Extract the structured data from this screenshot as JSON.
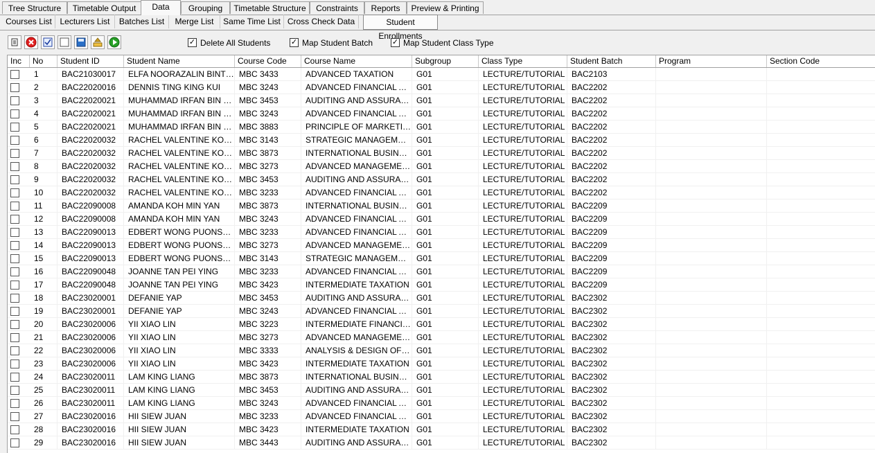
{
  "top_tabs": [
    "Tree Structure",
    "Timetable Output",
    "Data",
    "Grouping",
    "Timetable Structure",
    "Constraints",
    "Reports",
    "Preview & Printing"
  ],
  "active_top_tab": "Data",
  "sub_tabs": [
    "Courses List",
    "Lecturers List",
    "Batches List",
    "Merge List",
    "Same Time List",
    "Cross Check Data",
    "Student Enrollments"
  ],
  "active_sub_tab": "Student Enrollments",
  "toolbar": {
    "icons": [
      "delete-rows-icon",
      "cancel-icon",
      "check-all-icon",
      "uncheck-all-icon",
      "save-icon",
      "import-icon",
      "refresh-icon"
    ],
    "options": [
      {
        "label": "Delete All Students",
        "checked": true
      },
      {
        "label": "Map Student Batch",
        "checked": true
      },
      {
        "label": "Map Student Class Type",
        "checked": true
      }
    ]
  },
  "columns": [
    "Inc",
    "No",
    "Student ID",
    "Student Name",
    "Course Code",
    "Course Name",
    "Subgroup",
    "Class Type",
    "Student Batch",
    "Program",
    "Section Code"
  ],
  "rows": [
    [
      "1",
      "BAC21030017",
      "ELFA NOORAZALIN BINTI JAMAL",
      "MBC 3433",
      "ADVANCED TAXATION",
      "G01",
      "LECTURE/TUTORIAL",
      "BAC2103",
      "",
      ""
    ],
    [
      "2",
      "BAC22020016",
      "DENNIS TING KING KUI",
      "MBC 3243",
      "ADVANCED FINANCIAL ACCOUNTING",
      "G01",
      "LECTURE/TUTORIAL",
      "BAC2202",
      "",
      ""
    ],
    [
      "3",
      "BAC22020021",
      "MUHAMMAD IRFAN BIN HARUN",
      "MBC 3453",
      "AUDITING AND ASSURANCE",
      "G01",
      "LECTURE/TUTORIAL",
      "BAC2202",
      "",
      ""
    ],
    [
      "4",
      "BAC22020021",
      "MUHAMMAD IRFAN BIN HARUN",
      "MBC 3243",
      "ADVANCED FINANCIAL ACCOUNTING",
      "G01",
      "LECTURE/TUTORIAL",
      "BAC2202",
      "",
      ""
    ],
    [
      "5",
      "BAC22020021",
      "MUHAMMAD IRFAN BIN HARUN",
      "MBC 3883",
      "PRINCIPLE OF MARKETING",
      "G01",
      "LECTURE/TUTORIAL",
      "BAC2202",
      "",
      ""
    ],
    [
      "6",
      "BAC22020032",
      "RACHEL VALENTINE KONG",
      "MBC 3143",
      "STRATEGIC MANAGEMENT",
      "G01",
      "LECTURE/TUTORIAL",
      "BAC2202",
      "",
      ""
    ],
    [
      "7",
      "BAC22020032",
      "RACHEL VALENTINE KONG",
      "MBC 3873",
      "INTERNATIONAL BUSINESS",
      "G01",
      "LECTURE/TUTORIAL",
      "BAC2202",
      "",
      ""
    ],
    [
      "8",
      "BAC22020032",
      "RACHEL VALENTINE KONG",
      "MBC 3273",
      "ADVANCED MANAGEMENT ACCOUNTING",
      "G01",
      "LECTURE/TUTORIAL",
      "BAC2202",
      "",
      ""
    ],
    [
      "9",
      "BAC22020032",
      "RACHEL VALENTINE KONG",
      "MBC 3453",
      "AUDITING AND ASSURANCE",
      "G01",
      "LECTURE/TUTORIAL",
      "BAC2202",
      "",
      ""
    ],
    [
      "10",
      "BAC22020032",
      "RACHEL VALENTINE KONG",
      "MBC 3233",
      "ADVANCED FINANCIAL ACCOUNTING",
      "G01",
      "LECTURE/TUTORIAL",
      "BAC2202",
      "",
      ""
    ],
    [
      "11",
      "BAC22090008",
      "AMANDA KOH MIN YAN",
      "MBC 3873",
      "INTERNATIONAL BUSINESS",
      "G01",
      "LECTURE/TUTORIAL",
      "BAC2209",
      "",
      ""
    ],
    [
      "12",
      "BAC22090008",
      "AMANDA KOH MIN YAN",
      "MBC 3243",
      "ADVANCED FINANCIAL ACCOUNTING",
      "G01",
      "LECTURE/TUTORIAL",
      "BAC2209",
      "",
      ""
    ],
    [
      "13",
      "BAC22090013",
      "EDBERT WONG PUONSUN",
      "MBC 3233",
      "ADVANCED FINANCIAL ACCOUNTING",
      "G01",
      "LECTURE/TUTORIAL",
      "BAC2209",
      "",
      ""
    ],
    [
      "14",
      "BAC22090013",
      "EDBERT WONG PUONSUN",
      "MBC 3273",
      "ADVANCED MANAGEMENT ACCOUNTING",
      "G01",
      "LECTURE/TUTORIAL",
      "BAC2209",
      "",
      ""
    ],
    [
      "15",
      "BAC22090013",
      "EDBERT WONG PUONSUN",
      "MBC 3143",
      "STRATEGIC MANAGEMENT",
      "G01",
      "LECTURE/TUTORIAL",
      "BAC2209",
      "",
      ""
    ],
    [
      "16",
      "BAC22090048",
      "JOANNE TAN PEI YING",
      "MBC 3233",
      "ADVANCED FINANCIAL ACCOUNTING",
      "G01",
      "LECTURE/TUTORIAL",
      "BAC2209",
      "",
      ""
    ],
    [
      "17",
      "BAC22090048",
      "JOANNE TAN PEI YING",
      "MBC 3423",
      "INTERMEDIATE TAXATION",
      "G01",
      "LECTURE/TUTORIAL",
      "BAC2209",
      "",
      ""
    ],
    [
      "18",
      "BAC23020001",
      "DEFANIE YAP",
      "MBC 3453",
      "AUDITING AND ASSURANCE",
      "G01",
      "LECTURE/TUTORIAL",
      "BAC2302",
      "",
      ""
    ],
    [
      "19",
      "BAC23020001",
      "DEFANIE YAP",
      "MBC 3243",
      "ADVANCED FINANCIAL ACCOUNTING",
      "G01",
      "LECTURE/TUTORIAL",
      "BAC2302",
      "",
      ""
    ],
    [
      "20",
      "BAC23020006",
      "YII XIAO LIN",
      "MBC 3223",
      "INTERMEDIATE FINANCIAL ACCOUNTING",
      "G01",
      "LECTURE/TUTORIAL",
      "BAC2302",
      "",
      ""
    ],
    [
      "21",
      "BAC23020006",
      "YII XIAO LIN",
      "MBC 3273",
      "ADVANCED MANAGEMENT ACCOUNTING",
      "G01",
      "LECTURE/TUTORIAL",
      "BAC2302",
      "",
      ""
    ],
    [
      "22",
      "BAC23020006",
      "YII XIAO LIN",
      "MBC 3333",
      "ANALYSIS & DESIGN OF ACCOUNTING",
      "G01",
      "LECTURE/TUTORIAL",
      "BAC2302",
      "",
      ""
    ],
    [
      "23",
      "BAC23020006",
      "YII XIAO LIN",
      "MBC 3423",
      "INTERMEDIATE TAXATION",
      "G01",
      "LECTURE/TUTORIAL",
      "BAC2302",
      "",
      ""
    ],
    [
      "24",
      "BAC23020011",
      "LAM KING LIANG",
      "MBC 3873",
      "INTERNATIONAL BUSINESS",
      "G01",
      "LECTURE/TUTORIAL",
      "BAC2302",
      "",
      ""
    ],
    [
      "25",
      "BAC23020011",
      "LAM KING LIANG",
      "MBC 3453",
      "AUDITING AND ASSURANCE",
      "G01",
      "LECTURE/TUTORIAL",
      "BAC2302",
      "",
      ""
    ],
    [
      "26",
      "BAC23020011",
      "LAM KING LIANG",
      "MBC 3243",
      "ADVANCED FINANCIAL ACCOUNTING",
      "G01",
      "LECTURE/TUTORIAL",
      "BAC2302",
      "",
      ""
    ],
    [
      "27",
      "BAC23020016",
      "HII SIEW JUAN",
      "MBC 3233",
      "ADVANCED FINANCIAL ACCOUNTING",
      "G01",
      "LECTURE/TUTORIAL",
      "BAC2302",
      "",
      ""
    ],
    [
      "28",
      "BAC23020016",
      "HII SIEW JUAN",
      "MBC 3423",
      "INTERMEDIATE TAXATION",
      "G01",
      "LECTURE/TUTORIAL",
      "BAC2302",
      "",
      ""
    ],
    [
      "29",
      "BAC23020016",
      "HII SIEW JUAN",
      "MBC 3443",
      "AUDITING AND ASSURANCE",
      "G01",
      "LECTURE/TUTORIAL",
      "BAC2302",
      "",
      ""
    ]
  ]
}
